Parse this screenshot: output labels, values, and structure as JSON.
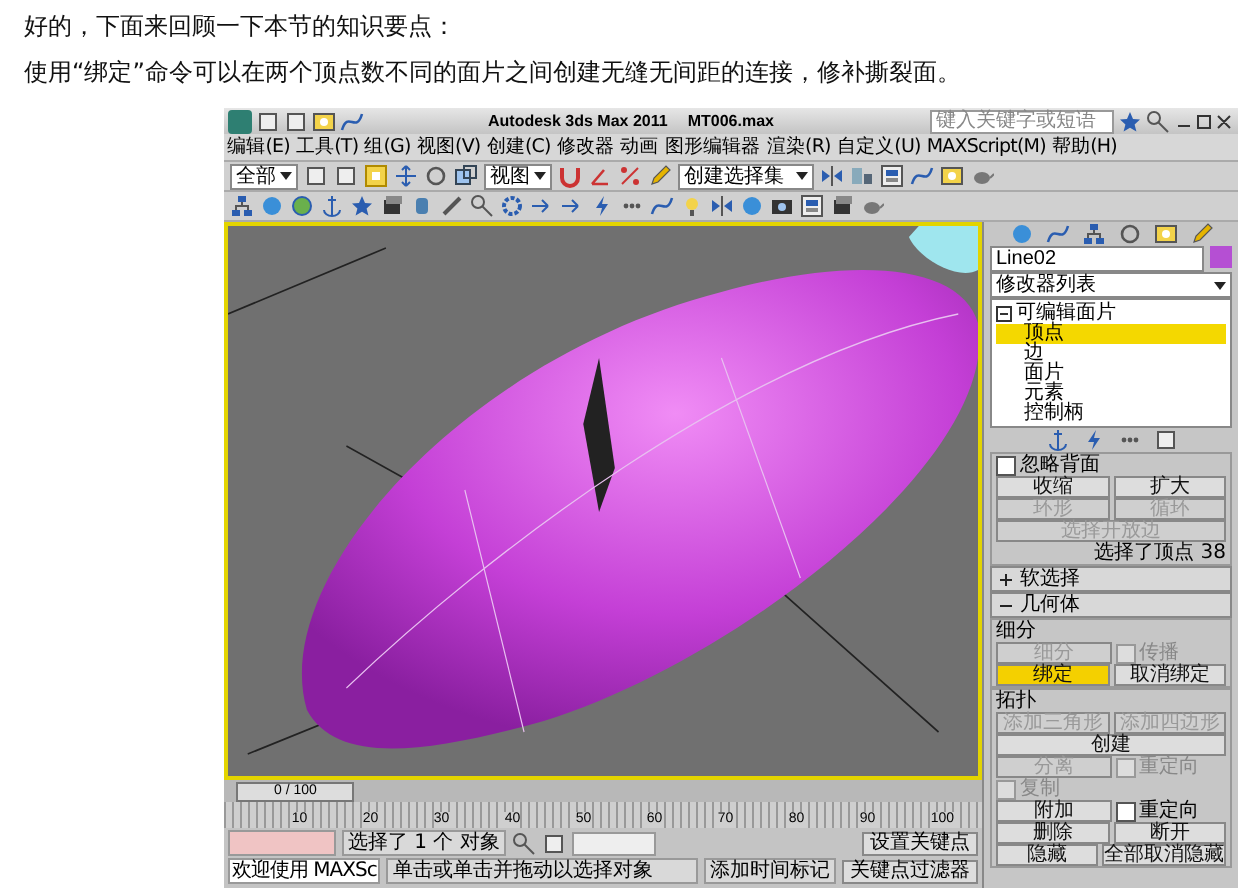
{
  "article": {
    "paragraphs": [
      "好的，下面来回顾一下本节的知识要点：",
      "使用“绑定”命令可以在两个顶点数不同的面片之间创建无缝无间距的连接，修补撕裂面。"
    ]
  },
  "app": {
    "title": "Autodesk 3ds Max 2011",
    "file": "MT006.max",
    "search": {
      "placeholder": "键入关键字或短语"
    },
    "menu": [
      "编辑(E)",
      "工具(T)",
      "组(G)",
      "视图(V)",
      "创建(C)",
      "修改器",
      "动画",
      "图形编辑器",
      "渲染(R)",
      "自定义(U)",
      "MAXScript(M)",
      "帮助(H)"
    ],
    "toolbar": {
      "selection_filter": "全部",
      "reference_system": "视图",
      "selection_set": "创建选择集"
    },
    "command_panel": {
      "object_name": "Line02",
      "modifier_list": "修改器列表",
      "stack": [
        {
          "label": "可编辑面片",
          "expanded": true,
          "children": [
            {
              "label": "顶点",
              "selected": true
            },
            {
              "label": "边",
              "selected": false
            },
            {
              "label": "面片",
              "selected": false
            },
            {
              "label": "元素",
              "selected": false
            },
            {
              "label": "控制柄",
              "selected": false
            }
          ]
        }
      ],
      "selection_rows": [
        [
          {
            "kind": "checkbox",
            "label": "忽略背面",
            "checked": false,
            "disabled": false
          }
        ],
        [
          {
            "kind": "button",
            "label": "收缩",
            "active": false,
            "disabled": false
          },
          {
            "kind": "button",
            "label": "扩大",
            "active": false,
            "disabled": false
          }
        ],
        [
          {
            "kind": "button",
            "label": "环形",
            "active": false,
            "disabled": true
          },
          {
            "kind": "button",
            "label": "循环",
            "active": false,
            "disabled": true
          }
        ],
        [
          {
            "kind": "button",
            "label": "选择开放边",
            "active": false,
            "disabled": true
          }
        ]
      ],
      "selection_info": "选择了顶点 38",
      "rollouts": [
        {
          "label": "软选择",
          "expanded": false
        },
        {
          "label": "几何体",
          "expanded": true
        }
      ],
      "geometry_groups": [
        {
          "title": "细分",
          "rows": [
            [
              {
                "kind": "button",
                "label": "细分",
                "active": false,
                "disabled": true
              },
              {
                "kind": "checkbox",
                "label": "传播",
                "checked": false,
                "disabled": true
              }
            ],
            [
              {
                "kind": "button",
                "label": "绑定",
                "active": true,
                "disabled": false
              },
              {
                "kind": "button",
                "label": "取消绑定",
                "active": false,
                "disabled": false
              }
            ]
          ]
        },
        {
          "title": "拓扑",
          "rows": [
            [
              {
                "kind": "button",
                "label": "添加三角形",
                "active": false,
                "disabled": true
              },
              {
                "kind": "button",
                "label": "添加四边形",
                "active": false,
                "disabled": true
              }
            ],
            [
              {
                "kind": "button",
                "label": "创建",
                "active": false,
                "disabled": false
              }
            ],
            [
              {
                "kind": "button",
                "label": "分离",
                "active": false,
                "disabled": true
              },
              {
                "kind": "checkbox",
                "label": "重定向",
                "checked": false,
                "disabled": true
              }
            ],
            [
              {
                "kind": "checkbox",
                "label": "复制",
                "checked": false,
                "disabled": true
              }
            ],
            [
              {
                "kind": "button",
                "label": "附加",
                "active": false,
                "disabled": false
              },
              {
                "kind": "checkbox",
                "label": "重定向",
                "checked": false,
                "disabled": false
              }
            ],
            [
              {
                "kind": "button",
                "label": "删除",
                "active": false,
                "disabled": false
              },
              {
                "kind": "button",
                "label": "断开",
                "active": false,
                "disabled": false
              }
            ],
            [
              {
                "kind": "button",
                "label": "隐藏",
                "active": false,
                "disabled": false
              },
              {
                "kind": "button",
                "label": "全部取消隐藏",
                "active": false,
                "disabled": false
              }
            ]
          ]
        }
      ]
    }
  },
  "timeline": {
    "slider": "0 / 100",
    "level": 0,
    "ticks": [
      "10",
      "20",
      "30",
      "40",
      "50",
      "60",
      "70",
      "80",
      "90",
      "100"
    ]
  },
  "status": {
    "selection": "选择了 1 个 对象",
    "prompt": "单击或单击并拖动以选择对象",
    "script": "欢迎使用 MAXSc",
    "time_tag": "添加时间标记",
    "set_key": "设置关键点",
    "key_filters": "关键点过滤器"
  }
}
